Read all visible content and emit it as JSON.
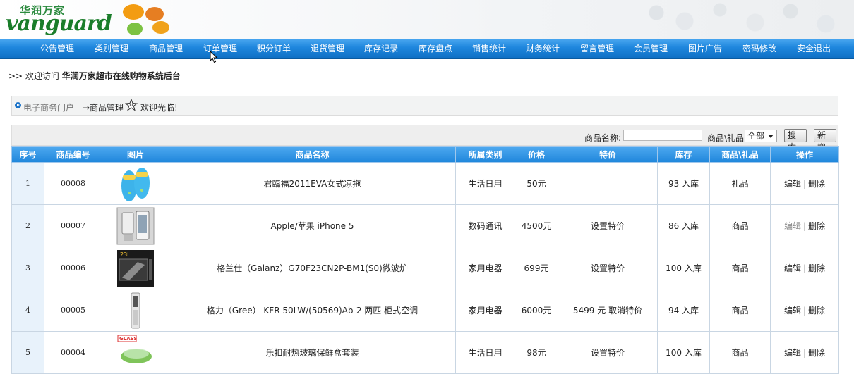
{
  "header": {
    "logo_cn": "华润万家",
    "logo_en": "vanguard"
  },
  "nav": {
    "items": [
      "公告管理",
      "类别管理",
      "商品管理",
      "订单管理",
      "积分订单",
      "退货管理",
      "库存记录",
      "库存盘点",
      "销售统计",
      "财务统计",
      "留言管理",
      "会员管理",
      "图片广告",
      "密码修改",
      "安全退出"
    ]
  },
  "welcome": {
    "prefix": ">> 欢迎访问",
    "site": "华润万家超市在线购物系统后台"
  },
  "breadcrumb": {
    "portal": "电子商务门户",
    "current": "→商品管理",
    "hello": "欢迎光临!"
  },
  "toolbar": {
    "name_label": "商品名称:",
    "name_value": "",
    "type_label": "商品\\礼品:",
    "type_selected": "全部",
    "search_label": "搜索",
    "add_label": "新增"
  },
  "table": {
    "headers": [
      "序号",
      "商品编号",
      "图片",
      "商品名称",
      "所属类别",
      "价格",
      "特价",
      "库存",
      "商品\\礼品",
      "操作"
    ],
    "rows": [
      {
        "idx": "1",
        "code": "00008",
        "img": "slipper",
        "name": "君臨福2011EVA女式凉拖",
        "category": "生活日用",
        "price": "50元",
        "special": "",
        "stock": "93 入库",
        "kind": "礼品",
        "edit": "编辑",
        "del": "删除"
      },
      {
        "idx": "2",
        "code": "00007",
        "img": "phone",
        "name": "Apple/苹果  iPhone 5",
        "category": "数码通讯",
        "price": "4500元",
        "special": "设置特价",
        "stock": "86 入库",
        "kind": "商品",
        "edit": "编辑",
        "del": "删除"
      },
      {
        "idx": "3",
        "code": "00006",
        "img": "microwave",
        "name": "格兰仕（Galanz）G70F23CN2P-BM1(S0)微波炉",
        "category": "家用电器",
        "price": "699元",
        "special": "设置特价",
        "stock": "100 入库",
        "kind": "商品",
        "edit": "编辑",
        "del": "删除"
      },
      {
        "idx": "4",
        "code": "00005",
        "img": "aircon",
        "name": "格力（Gree）  KFR-50LW/(50569)Ab-2 两匹  柜式空调",
        "category": "家用电器",
        "price": "6000元",
        "special": "5499 元  取消特价",
        "stock": "94 入库",
        "kind": "商品",
        "edit": "编辑",
        "del": "删除"
      },
      {
        "idx": "5",
        "code": "00004",
        "img": "glass",
        "name": "乐扣耐热玻璃保鲜盒套装",
        "category": "生活日用",
        "price": "98元",
        "special": "设置特价",
        "stock": "100 入库",
        "kind": "商品",
        "edit": "编辑",
        "del": "删除"
      }
    ]
  },
  "colors": {
    "nav": "#1e86dd",
    "header_row": "#2b8de0",
    "brand_green": "#1a7d2a"
  }
}
